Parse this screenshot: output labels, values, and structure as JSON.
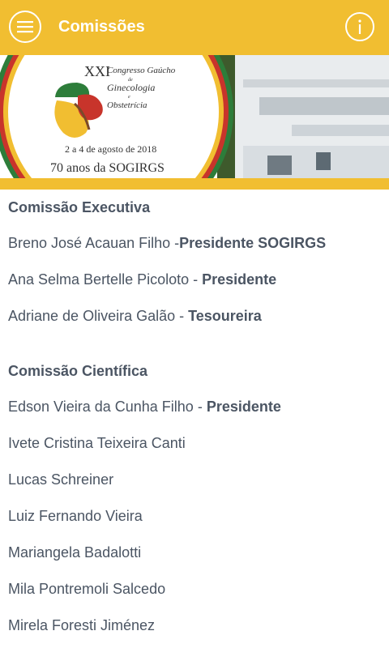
{
  "appbar": {
    "title": "Comissões",
    "menu_icon": "hamburger-menu-icon",
    "info_icon": "info-icon",
    "color": "#f1be31"
  },
  "banner": {
    "edition": "XXI",
    "congress_line1": "Congresso Gaúcho",
    "congress_line2": "de",
    "congress_line3": "Ginecologia",
    "congress_line4": "e",
    "congress_line5": "Obstetrícia",
    "dates": "2 a 4 de agosto de 2018",
    "anniversary": "70 anos da SOGIRGS"
  },
  "sections": [
    {
      "title": "Comissão Executiva",
      "members": [
        {
          "name": "Breno José Acauan Filho -",
          "role": "Presidente SOGIRGS"
        },
        {
          "name": "Ana Selma Bertelle Picoloto - ",
          "role": "Presidente"
        },
        {
          "name": "Adriane de Oliveira Galão - ",
          "role": "Tesoureira"
        }
      ]
    },
    {
      "title": "Comissão Científica",
      "members": [
        {
          "name": "Edson Vieira da Cunha Filho - ",
          "role": "Presidente"
        },
        {
          "name": "Ivete Cristina Teixeira Canti",
          "role": ""
        },
        {
          "name": "Lucas Schreiner",
          "role": ""
        },
        {
          "name": "Luiz Fernando Vieira",
          "role": ""
        },
        {
          "name": "Mariangela Badalotti",
          "role": ""
        },
        {
          "name": "Mila Pontremoli Salcedo",
          "role": ""
        },
        {
          "name": "Mirela Foresti Jiménez",
          "role": ""
        }
      ]
    }
  ]
}
